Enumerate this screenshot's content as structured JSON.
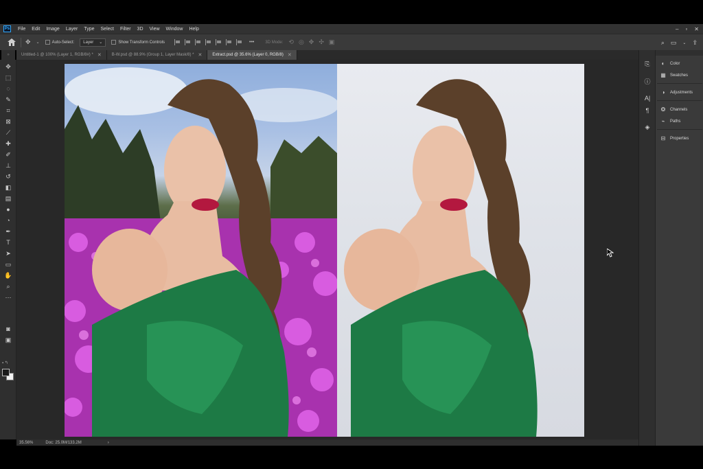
{
  "app": {
    "logo": "Ps"
  },
  "menu": [
    "File",
    "Edit",
    "Image",
    "Layer",
    "Type",
    "Select",
    "Filter",
    "3D",
    "View",
    "Window",
    "Help"
  ],
  "window_controls": [
    "–",
    "▫",
    "✕"
  ],
  "options": {
    "auto_select_label": "Auto-Select:",
    "auto_select_value": "Layer",
    "show_transform_label": "Show Transform Controls",
    "mode_3d_label": "3D Mode:",
    "more_label": "•••"
  },
  "tabs": [
    {
      "label": "Untitled-1 @ 100% (Layer 1, RGB/8#) *",
      "active": false
    },
    {
      "label": "B-W.psd @ 88.9% (Group 1, Layer Mask/8) *",
      "active": false
    },
    {
      "label": "Extract.psd @ 35.6% (Layer 0, RGB/8)",
      "active": true
    }
  ],
  "status": {
    "zoom": "35.56%",
    "doc": "Doc: 25.0M/133.2M",
    "arrow": "›"
  },
  "panels": [
    {
      "label": "Color",
      "icon": "color-icon"
    },
    {
      "label": "Swatches",
      "icon": "swatches-icon"
    },
    {
      "label": "Adjustments",
      "icon": "adjustments-icon"
    },
    {
      "label": "Channels",
      "icon": "channels-icon"
    },
    {
      "label": "Paths",
      "icon": "paths-icon"
    },
    {
      "label": "Properties",
      "icon": "properties-icon"
    }
  ],
  "colors": {
    "accent": "#31a8ff",
    "canvas_bg": "#282828",
    "panel_bg": "#3a3a3a"
  }
}
